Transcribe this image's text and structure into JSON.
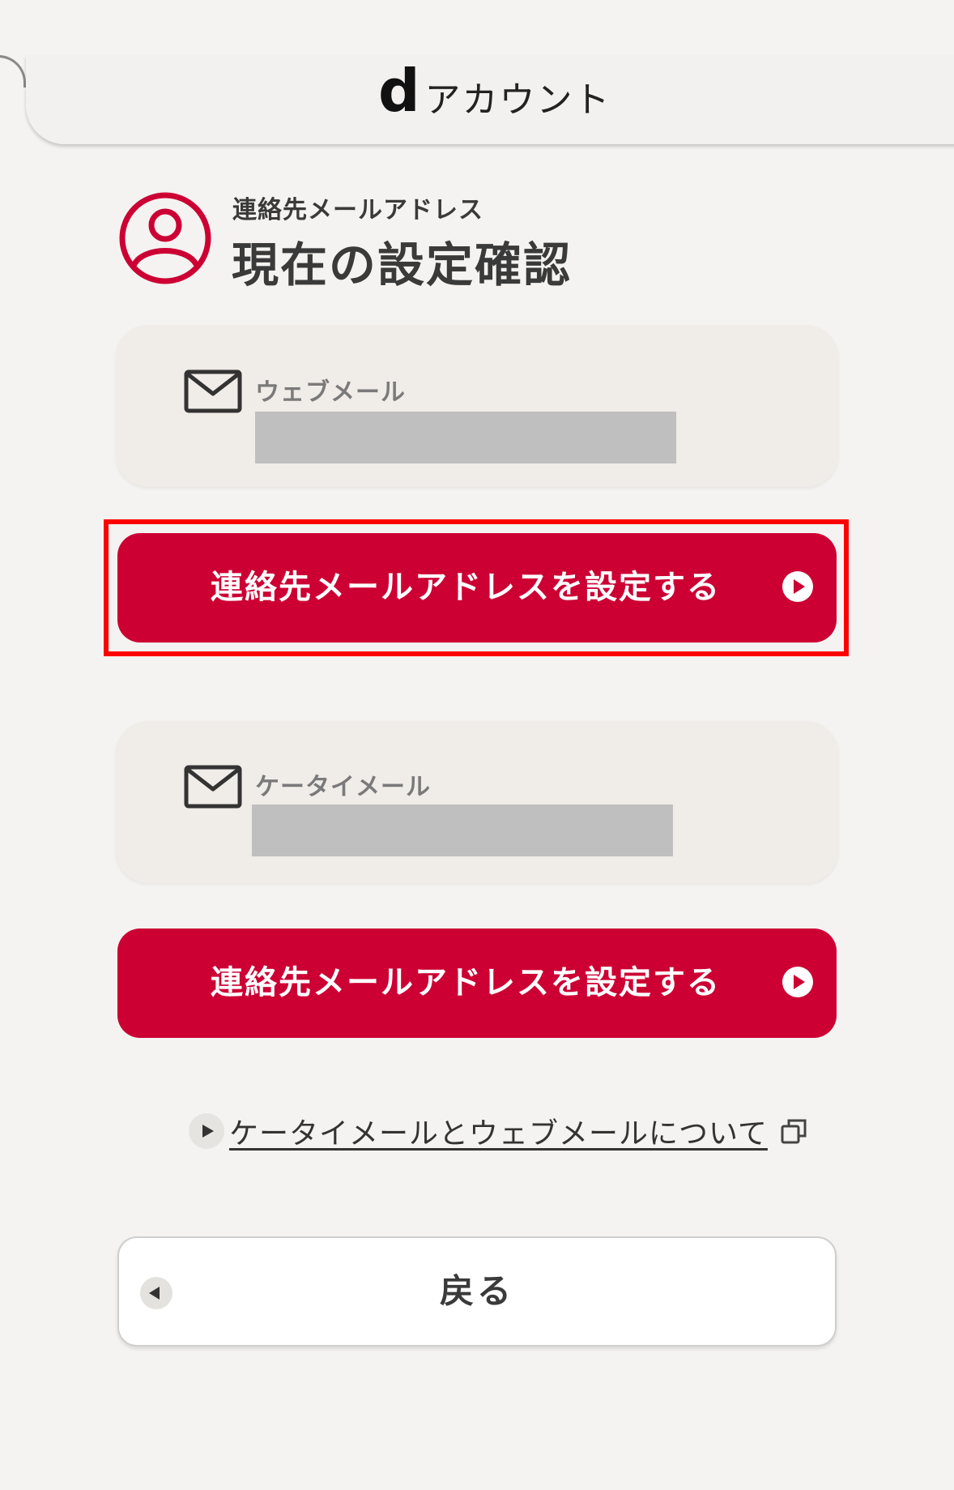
{
  "header": {
    "brand_mark": "d",
    "brand_text": "アカウント"
  },
  "page": {
    "subtitle": "連絡先メールアドレス",
    "title": "現在の設定確認",
    "title_icon": "user-circle-icon"
  },
  "sections": [
    {
      "label": "ウェブメール",
      "icon": "mail-icon",
      "value": "",
      "button_label": "連絡先メールアドレスを設定する"
    },
    {
      "label": "ケータイメール",
      "icon": "mail-icon",
      "value": "",
      "button_label": "連絡先メールアドレスを設定する"
    }
  ],
  "info_link": {
    "text": "ケータイメールとウェブメールについて",
    "icon": "external-window-icon"
  },
  "back_button": {
    "label": "戻る"
  },
  "colors": {
    "accent": "#cc0033",
    "background": "#f4f3f1",
    "highlight": "#ff0000",
    "masked": "#bfbfbf"
  }
}
